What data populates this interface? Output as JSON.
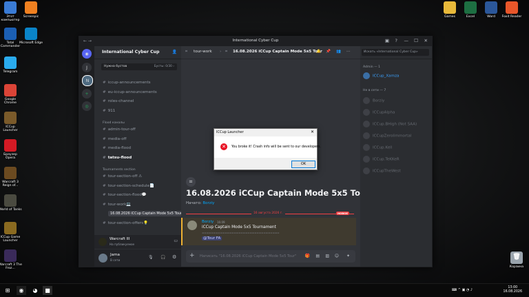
{
  "desktop_left": [
    {
      "label": "Этот компьютер",
      "icon": "computer-icon",
      "color": "#3a7bd5"
    },
    {
      "label": "Total Commander",
      "icon": "total-commander-icon",
      "color": "#1b5fb4"
    },
    {
      "label": "Telegram",
      "icon": "telegram-icon",
      "color": "#2aabee"
    },
    {
      "label": "Google Chrome",
      "icon": "chrome-icon",
      "color": "#db4437"
    },
    {
      "label": "ICCup Launcher",
      "icon": "iccup-icon",
      "color": "#7a5a2a"
    },
    {
      "label": "Браузер Opera",
      "icon": "opera-icon",
      "color": "#d41a24"
    },
    {
      "label": "Warcraft 3 Reign of...",
      "icon": "warcraft-icon",
      "color": "#6b4a20"
    },
    {
      "label": "World of Tanks",
      "icon": "tanks-icon",
      "color": "#4a4a40"
    },
    {
      "label": "ICCup Game Launcher",
      "icon": "iccup-game-icon",
      "color": "#8a6a20"
    },
    {
      "label": "Warcraft 3 The Froz...",
      "icon": "frozen-throne-icon",
      "color": "#3a2a5a"
    }
  ],
  "desktop_left2": [
    {
      "label": "Screenpic",
      "icon": "screenpic-icon",
      "color": "#f08020"
    },
    {
      "label": "Microsoft Edge",
      "icon": "edge-icon",
      "color": "#0a84c8"
    }
  ],
  "desktop_right": [
    {
      "label": "Games",
      "icon": "folder-icon",
      "color": "#e8b93a"
    },
    {
      "label": "Excel",
      "icon": "excel-icon",
      "color": "#1d6f42"
    },
    {
      "label": "Word",
      "icon": "word-icon",
      "color": "#2b579a"
    },
    {
      "label": "Foxit Reader",
      "icon": "foxit-icon",
      "color": "#e8562a"
    }
  ],
  "recycle_bin": "Корзина",
  "window_title": "International Cyber Cup",
  "server": {
    "name": "International Cyber Cup",
    "boost_left": "Нужна бустов",
    "boost_right": "Бусты: 0/30 ›"
  },
  "channels_top": [
    "iccup-announcements",
    "eu-iccup-announcements",
    "roles-channel",
    "911"
  ],
  "flood_category": "Flood каналы",
  "flood_channels": [
    "admin-tour-off",
    "media-off",
    "media-flood",
    "tatsu-flood"
  ],
  "tour_category": "Tournaments section",
  "tour_channels": [
    "tour-section-off ⚠",
    "tour-section-schedule📄",
    "tour-section-flood💬",
    "tour-work💻"
  ],
  "active_thread": "16.08.2026 iCCup Captain Mode 5x5 Tour",
  "tour_offers": "tour-section-offers💡",
  "voice": {
    "title": "Warcraft III",
    "sub": "На публикуемое"
  },
  "user": {
    "name": "Jama",
    "status": "В сети"
  },
  "chat": {
    "channel": "tour-work",
    "thread": "16.08.2026 iCCup Captain Mode 5x5 Tour",
    "big_title": "16.08.2026 iCCup Captain Mode 5x5 Tour",
    "started_label": "Начато:",
    "started_user": "Borziy",
    "divider_date": "16 августа 2026 г.",
    "new_tag": "НОВОЕ",
    "msg_author": "Borziy",
    "msg_time": "16:09",
    "msg_line1": "iCCup Captain Mode 5x5 Tournament",
    "msg_line2": "==================================",
    "msg_mention": "@Tour FA",
    "input_placeholder": "Написать \"16.08.2026 iCCup Captain Mode 5x5 Tour\""
  },
  "members": {
    "search": "Искать «International Cyber Cup»",
    "admin_cat": "Admin — 1",
    "admin": "ICCup_Xamza",
    "online_cat": "Не в сети — 7",
    "offline": [
      "Borziy",
      "ICCupAlpha",
      "ICCup.BHigh (Not SAA)",
      "ICCupZerolimmortal",
      "ICCup.Kell",
      "ICCup.TeKKeR",
      "ICCupTheWest"
    ]
  },
  "dialog": {
    "title": "ICCup Launcher",
    "message": "You broke it! Crash info will be sent to our developers.",
    "ok": "OK"
  },
  "clock": {
    "time": "13:00",
    "date": "16.08.2026"
  }
}
